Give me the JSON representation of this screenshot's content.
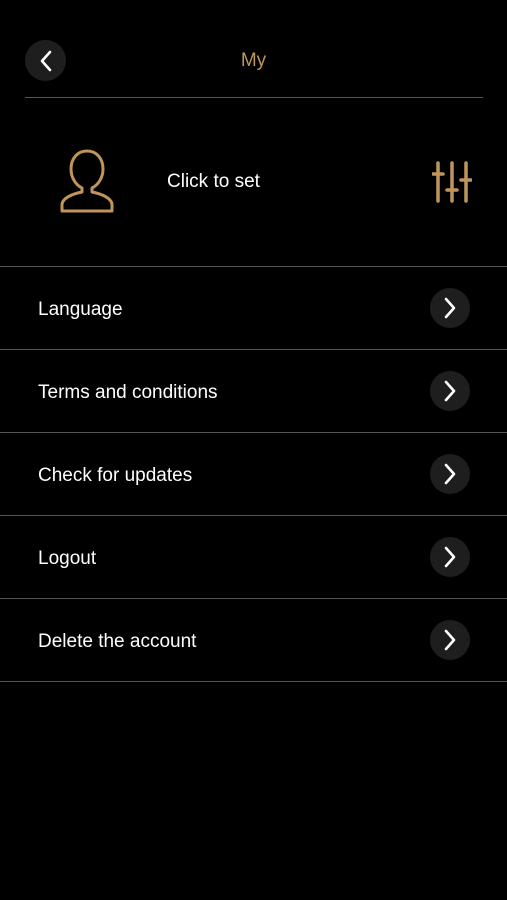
{
  "header": {
    "title": "My",
    "back_icon": "chevron-left-icon"
  },
  "profile": {
    "avatar_icon": "user-outline-icon",
    "label": "Click to set",
    "settings_icon": "sliders-icon"
  },
  "menu": {
    "items": [
      {
        "label": "Language",
        "icon": "chevron-right-icon"
      },
      {
        "label": "Terms and conditions",
        "icon": "chevron-right-icon"
      },
      {
        "label": "Check for updates",
        "icon": "chevron-right-icon"
      },
      {
        "label": "Logout",
        "icon": "chevron-right-icon"
      },
      {
        "label": "Delete the account",
        "icon": "chevron-right-icon"
      }
    ]
  },
  "colors": {
    "background": "#000000",
    "accent": "#c0955c",
    "text": "#ffffff",
    "divider": "#555555",
    "button_bg": "#1e1e1e"
  }
}
